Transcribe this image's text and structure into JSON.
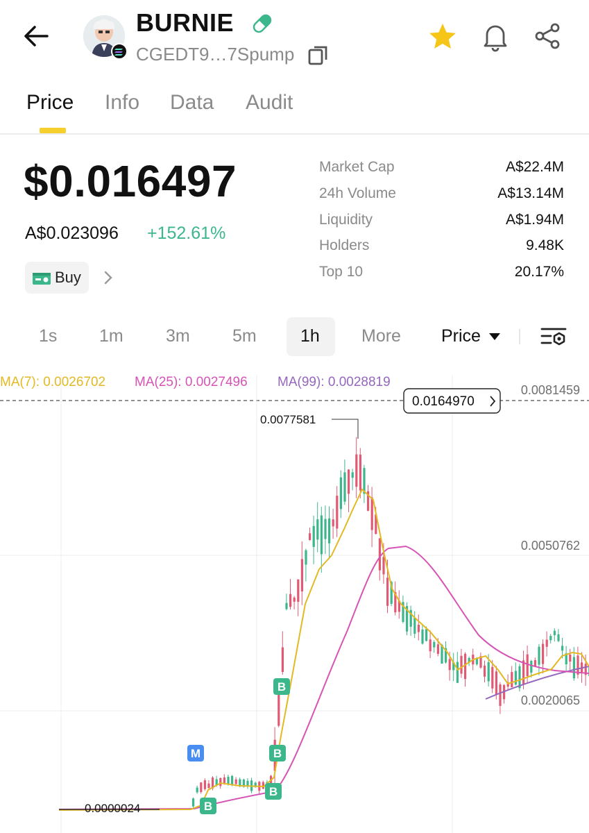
{
  "header": {
    "token_name": "BURNIE",
    "address": "CGEDT9…7Spump"
  },
  "tabs": [
    {
      "label": "Price",
      "active": true
    },
    {
      "label": "Info",
      "active": false
    },
    {
      "label": "Data",
      "active": false
    },
    {
      "label": "Audit",
      "active": false
    }
  ],
  "price": {
    "usd": "$0.016497",
    "aud": "A$0.023096",
    "change": "+152.61%",
    "buy_label": "Buy"
  },
  "stats": [
    {
      "label": "Market Cap",
      "value": "A$22.4M"
    },
    {
      "label": "24h Volume",
      "value": "A$13.14M"
    },
    {
      "label": "Liquidity",
      "value": "A$1.94M"
    },
    {
      "label": "Holders",
      "value": "9.48K"
    },
    {
      "label": "Top 10",
      "value": "20.17%"
    }
  ],
  "intervals": {
    "items": [
      "1s",
      "1m",
      "3m",
      "5m",
      "1h",
      "More"
    ],
    "selected": "1h",
    "price_mode": "Price"
  },
  "chart": {
    "ma7": "MA(7): 0.0026702",
    "ma25": "MA(25): 0.0027496",
    "ma99": "MA(99): 0.0028819",
    "axis_top": "0.0081459",
    "axis_mid": "0.0050762",
    "current_price_tag": "0.0164970",
    "high_label": "0.0077581",
    "low_label_left": "0.0000024",
    "low_label_right": "0.0020065",
    "marker_m": "M",
    "marker_b": "B",
    "colors": {
      "up": "#3cb78b",
      "down": "#e15a73",
      "ma7": "#e2b923",
      "ma25": "#d653b5",
      "ma99": "#9467bd",
      "accent": "#f5cf2e"
    }
  }
}
